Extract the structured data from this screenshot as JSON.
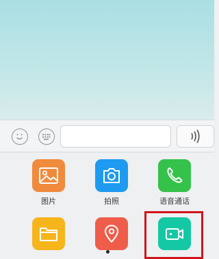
{
  "composer": {
    "emoji_icon": "smiley-face-icon",
    "keyboard_icon": "keyboard-icon",
    "message_placeholder": "",
    "voice_icon": "sound-waves-icon"
  },
  "apps": [
    {
      "label": "图片",
      "icon": "image-icon",
      "color": "#f08a3d"
    },
    {
      "label": "拍照",
      "icon": "camera-icon",
      "color": "#1e9bf0"
    },
    {
      "label": "语音通话",
      "icon": "phone-icon",
      "color": "#35c24a"
    },
    {
      "label": "",
      "icon": "folder-icon",
      "color": "#f7b51c"
    },
    {
      "label": "",
      "icon": "location-pin-icon",
      "color": "#ee5d4a"
    },
    {
      "label": "",
      "icon": "video-camera-icon",
      "color": "#15c8a4"
    }
  ],
  "highlight_color": "#d0141a"
}
